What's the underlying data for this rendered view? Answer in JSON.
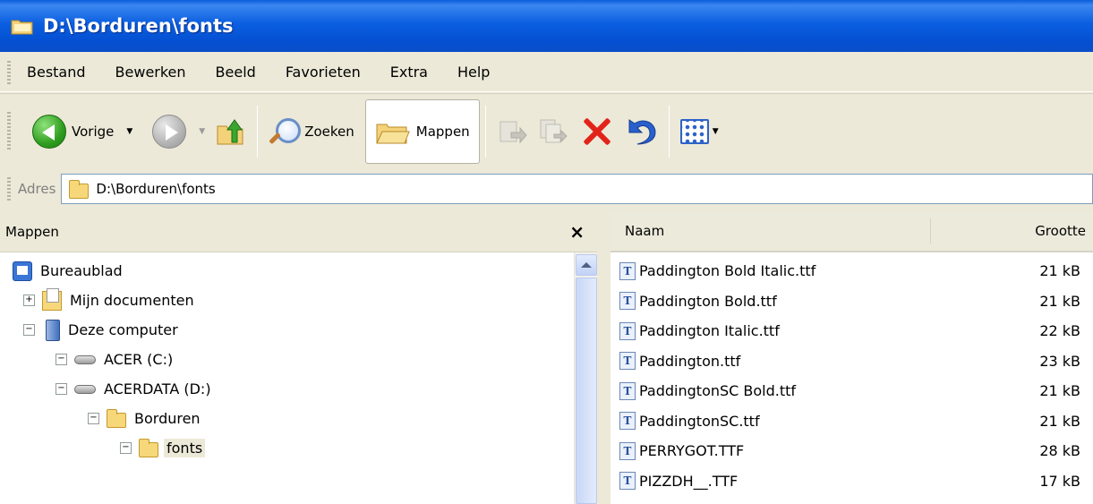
{
  "window": {
    "title": "D:\\Borduren\\fonts"
  },
  "menu": {
    "items": [
      "Bestand",
      "Bewerken",
      "Beeld",
      "Favorieten",
      "Extra",
      "Help"
    ]
  },
  "toolbar": {
    "back_label": "Vorige",
    "search_label": "Zoeken",
    "folders_label": "Mappen"
  },
  "address": {
    "label": "Adres",
    "value": "D:\\Borduren\\fonts"
  },
  "folders_pane": {
    "title": "Mappen",
    "close": "×",
    "tree": [
      {
        "label": "Bureaublad"
      },
      {
        "label": "Mijn documenten",
        "expander": "+"
      },
      {
        "label": "Deze computer",
        "expander": "−"
      },
      {
        "label": "ACER (C:)",
        "expander": "−"
      },
      {
        "label": "ACERDATA (D:)",
        "expander": "−"
      },
      {
        "label": "Borduren",
        "expander": "−"
      },
      {
        "label": "fonts",
        "expander": "−",
        "selected": true
      }
    ]
  },
  "files_pane": {
    "columns": {
      "name": "Naam",
      "size": "Grootte"
    },
    "files": [
      {
        "name": "Paddington Bold Italic.ttf",
        "size": "21 kB"
      },
      {
        "name": "Paddington Bold.ttf",
        "size": "21 kB"
      },
      {
        "name": "Paddington Italic.ttf",
        "size": "22 kB"
      },
      {
        "name": "Paddington.ttf",
        "size": "23 kB"
      },
      {
        "name": "PaddingtonSC Bold.ttf",
        "size": "21 kB"
      },
      {
        "name": "PaddingtonSC.ttf",
        "size": "21 kB"
      },
      {
        "name": "PERRYGOT.TTF",
        "size": "28 kB"
      },
      {
        "name": "PIZZDH__.TTF",
        "size": "17 kB"
      }
    ],
    "file_icon_glyph": "T"
  },
  "colors": {
    "titlebar": "#0b5fe0",
    "chrome": "#ece9d8",
    "delete": "#e2231a"
  }
}
